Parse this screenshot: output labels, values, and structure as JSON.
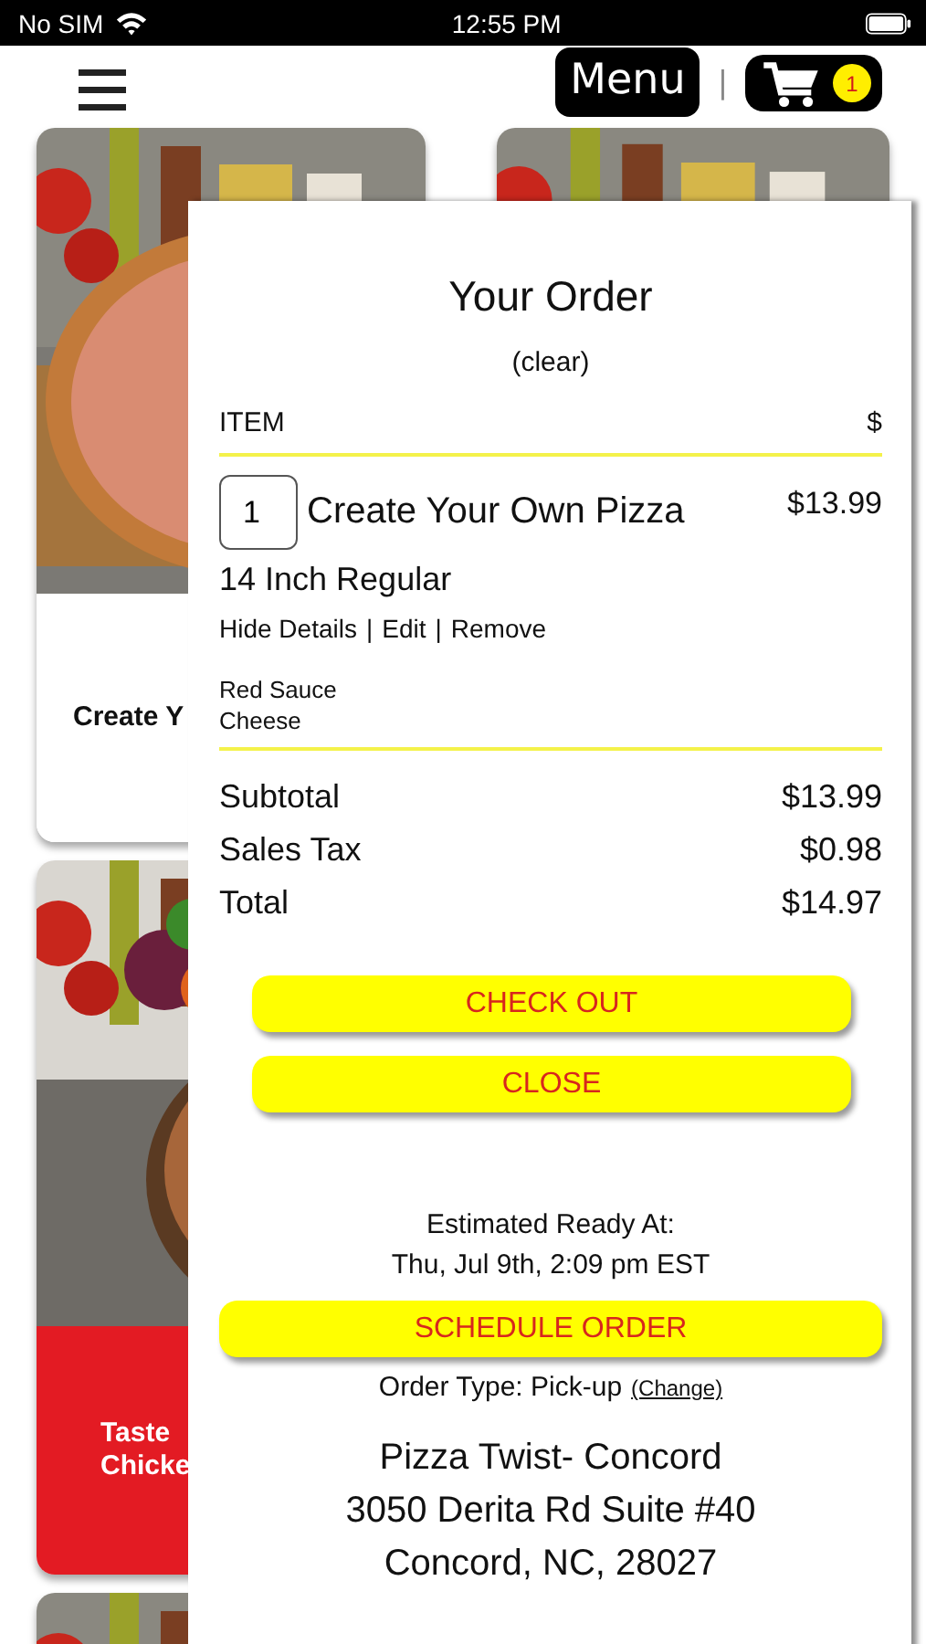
{
  "status_bar": {
    "carrier": "No SIM",
    "time": "12:55 PM"
  },
  "header": {
    "menu_label": "Menu",
    "separator": "|",
    "cart_count": "1"
  },
  "left_cards": [
    {
      "kind": "plain",
      "title_lines": [
        "Create Y"
      ]
    },
    {
      "kind": "promo",
      "title_lines": [
        "Taste",
        "Chicke"
      ]
    },
    {
      "kind": "picture"
    }
  ],
  "right_cards": [
    {
      "kind": "picture"
    }
  ],
  "order": {
    "title": "Your Order",
    "clear_link": "(clear)",
    "columns": [
      "ITEM",
      "$"
    ],
    "items": [
      {
        "quantity": "1",
        "name": "Create Your Own Pizza",
        "price": "$13.99",
        "size": "14 Inch Regular",
        "details_expanded": true,
        "actions": [
          "Hide Details",
          "Edit",
          "Remove"
        ],
        "separator": "|",
        "options": [
          "Red Sauce",
          "Cheese"
        ]
      }
    ],
    "totals": [
      {
        "label": "Subtotal",
        "amount": "$13.99"
      },
      {
        "label": "Sales Tax",
        "amount": "$0.98"
      },
      {
        "label": "Total",
        "amount": "$14.97"
      }
    ],
    "buttons": [
      "CHECK OUT",
      "CLOSE"
    ],
    "ready_label": "Estimated Ready At:",
    "ready_time": "Thu, Jul 9th, 2:09 pm EST",
    "schedule_button": "SCHEDULE ORDER",
    "order_type": "Order Type: Pick-up",
    "change_link": "(Change)",
    "store_lines": [
      "Pizza Twist- Concord",
      "3050 Derita Rd Suite #40",
      "Concord, NC, 28027"
    ]
  }
}
